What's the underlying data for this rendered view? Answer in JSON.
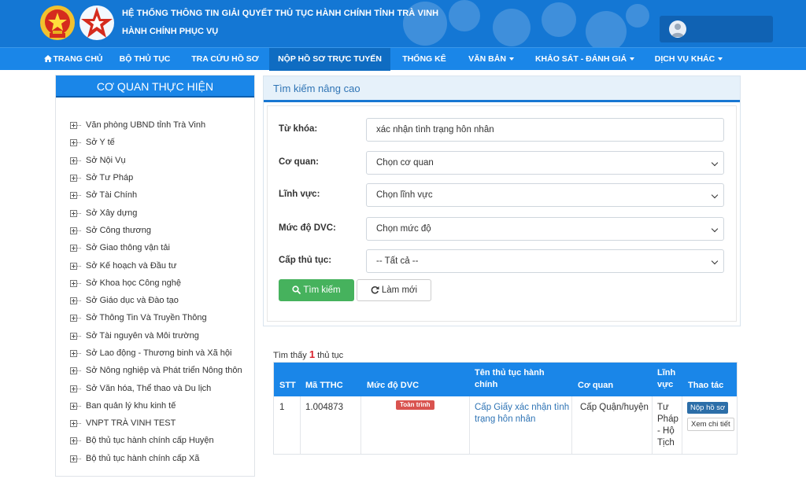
{
  "header": {
    "title": "HỆ THỐNG THÔNG TIN GIẢI QUYẾT THỦ TỤC HÀNH CHÍNH TỈNH TRÀ VINH",
    "subtitle": "HÀNH CHÍNH PHỤC VỤ"
  },
  "nav": {
    "items": [
      {
        "label": "TRANG CHỦ"
      },
      {
        "label": "BỘ THỦ TỤC"
      },
      {
        "label": "TRA CỨU HỒ SƠ"
      },
      {
        "label": "NỘP HỒ SƠ TRỰC TUYẾN"
      },
      {
        "label": "THỐNG KÊ"
      },
      {
        "label": "VĂN BẢN"
      },
      {
        "label": "KHẢO SÁT - ĐÁNH GIÁ"
      },
      {
        "label": "DỊCH VỤ KHÁC"
      }
    ]
  },
  "sidebar": {
    "title": "CƠ QUAN THỰC HIỆN",
    "items": [
      "Văn phòng UBND tỉnh Trà Vinh",
      "Sở Y tế",
      "Sở Nội Vụ",
      "Sở Tư Pháp",
      "Sở Tài Chính",
      "Sở Xây dựng",
      "Sở Công thương",
      "Sở Giao thông vận tải",
      "Sở Kế hoạch và Đầu tư",
      "Sở Khoa học Công nghệ",
      "Sở Giáo dục và Đào tạo",
      "Sở Thông Tin Và Truyền Thông",
      "Sở Tài nguyên và Môi trường",
      "Sở Lao động - Thương binh và Xã hội",
      "Sở Nông nghiệp và Phát triển Nông thôn",
      "Sở Văn hóa, Thể thao và Du lịch",
      "Ban quản lý khu kinh tế",
      "VNPT TRÀ VINH TEST",
      "Bộ thủ tục hành chính cấp Huyện",
      "Bộ thủ tục hành chính cấp Xã"
    ]
  },
  "search": {
    "title": "Tìm kiếm nâng cao",
    "keyword_label": "Từ khóa:",
    "keyword_value": "xác nhận tình trạng hôn nhân",
    "agency_label": "Cơ quan:",
    "agency_value": "Chọn cơ quan",
    "field_label": "Lĩnh vực:",
    "field_value": "Chọn lĩnh vực",
    "level_label": "Mức độ DVC:",
    "level_value": "Chọn mức độ",
    "tier_label": "Cấp thủ tục:",
    "tier_value": "-- Tất cả --",
    "search_button": "Tìm kiếm",
    "reset_button": "Làm mới"
  },
  "results": {
    "found_prefix": "Tìm thấy",
    "found_count": "1",
    "found_suffix": "thủ tục",
    "columns": {
      "stt": "STT",
      "code": "Mã TTHC",
      "level": "Mức độ DVC",
      "name_1": "Tên thủ tục hành",
      "name_2": "chính",
      "agency": "Cơ quan",
      "field_1": "Lĩnh",
      "field_2": "vực",
      "action": "Thao tác"
    },
    "rows": [
      {
        "stt": "1",
        "code": "1.004873",
        "level": "Toàn trình",
        "name_1": "Cấp Giấy xác nhận tình",
        "name_2": "trạng hôn nhân",
        "agency": "Cấp Quận/huyện",
        "field_1": "Tư",
        "field_2": "Pháp",
        "field_3": "- Hộ",
        "field_4": "Tịch",
        "submit": "Nộp hồ sơ",
        "detail": "Xem chi tiết"
      }
    ]
  },
  "colors": {
    "header_blue": "#1477d4",
    "nav_blue": "#1a86e8",
    "search_green": "#46b25d",
    "badge_red": "#d9534f"
  }
}
